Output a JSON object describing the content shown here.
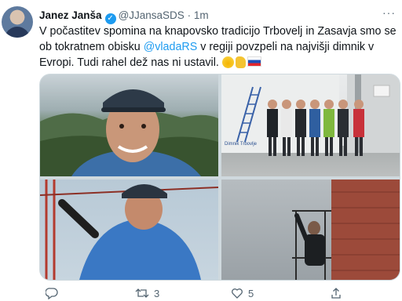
{
  "tweet": {
    "author_name": "Janez Janša",
    "handle": "@JJansaSDS",
    "separator": "·",
    "time": "1m",
    "text_parts": {
      "p1": "V počastitev spomina na knapovsko tradicijo Trbovelj in Zasavja smo se ob tokratnem obisku ",
      "mention": "@vladaRS",
      "p2": " v regiji povzpeli na najvišji dimnik v Evropi. Tudi rahel dež nas ni ustavil. "
    },
    "emojis": [
      "grinning-face",
      "thumbs-up",
      "slovenia-flag"
    ],
    "photo_sign": "Dimnik Trbovlje"
  },
  "actions": {
    "replies": "",
    "retweets": "3",
    "likes": "5"
  },
  "colors": {
    "accent": "#1d9bf0",
    "muted": "#536471",
    "text": "#0f1419"
  }
}
